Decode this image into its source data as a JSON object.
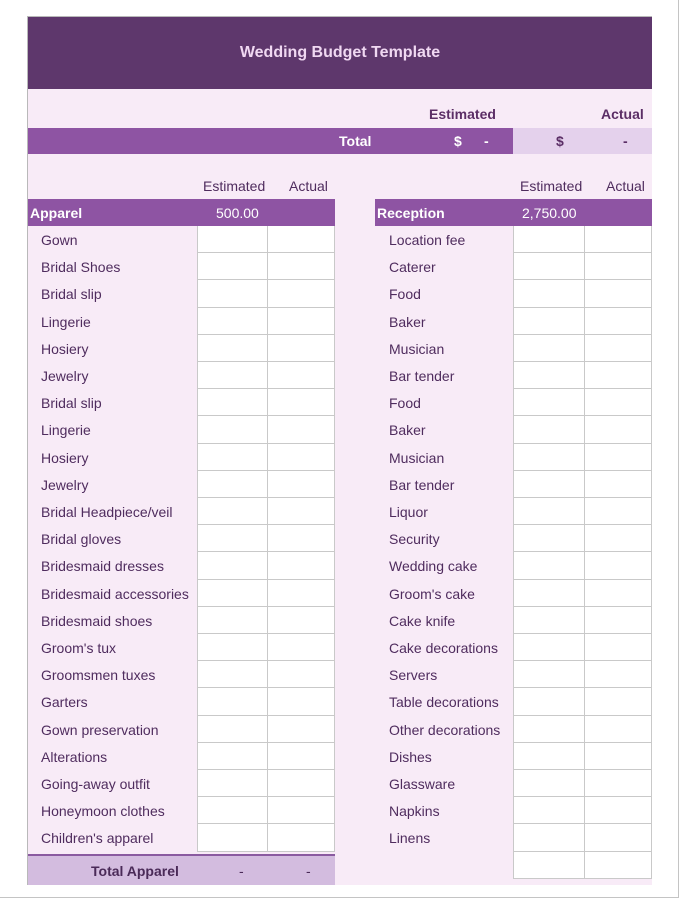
{
  "title": "Wedding Budget Template",
  "summary": {
    "estimated_header": "Estimated",
    "actual_header": "Actual",
    "total_label": "Total",
    "estimated_currency": "$",
    "estimated_value": "-",
    "actual_currency": "$",
    "actual_value": "-"
  },
  "apparel": {
    "col_estimated": "Estimated",
    "col_actual": "Actual",
    "title": "Apparel",
    "estimated_total": "500.00",
    "items": [
      "Gown",
      "Bridal Shoes",
      "Bridal slip",
      "Lingerie",
      "Hosiery",
      "Jewelry",
      "Bridal slip",
      "Lingerie",
      "Hosiery",
      "Jewelry",
      "Bridal Headpiece/veil",
      "Bridal gloves",
      "Bridesmaid dresses",
      "Bridesmaid accessories",
      "Bridesmaid shoes",
      "Groom's tux",
      "Groomsmen tuxes",
      "Garters",
      "Gown preservation",
      "Alterations",
      "Going-away outfit",
      "Honeymoon clothes",
      "Children's apparel"
    ],
    "footer_label": "Total Apparel",
    "footer_estimated": "-",
    "footer_actual": "-"
  },
  "reception": {
    "col_estimated": "Estimated",
    "col_actual": "Actual",
    "title": "Reception",
    "estimated_total": "2,750.00",
    "items": [
      "Location fee",
      "Caterer",
      "Food",
      "Baker",
      "Musician",
      "Bar tender",
      "Food",
      "Baker",
      "Musician",
      "Bar tender",
      "Liquor",
      "Security",
      "Wedding cake",
      "Groom's cake",
      "Cake knife",
      "Cake decorations",
      "Servers",
      "Table decorations",
      "Other decorations",
      "Dishes",
      "Glassware",
      "Napkins",
      "Linens"
    ]
  },
  "colors": {
    "title_bg": "#5e376c",
    "section_bg": "#8e54a3",
    "sheet_bg": "#f8ebf7",
    "footer_bg": "#d3bcdf",
    "text": "#4f2c5e"
  }
}
